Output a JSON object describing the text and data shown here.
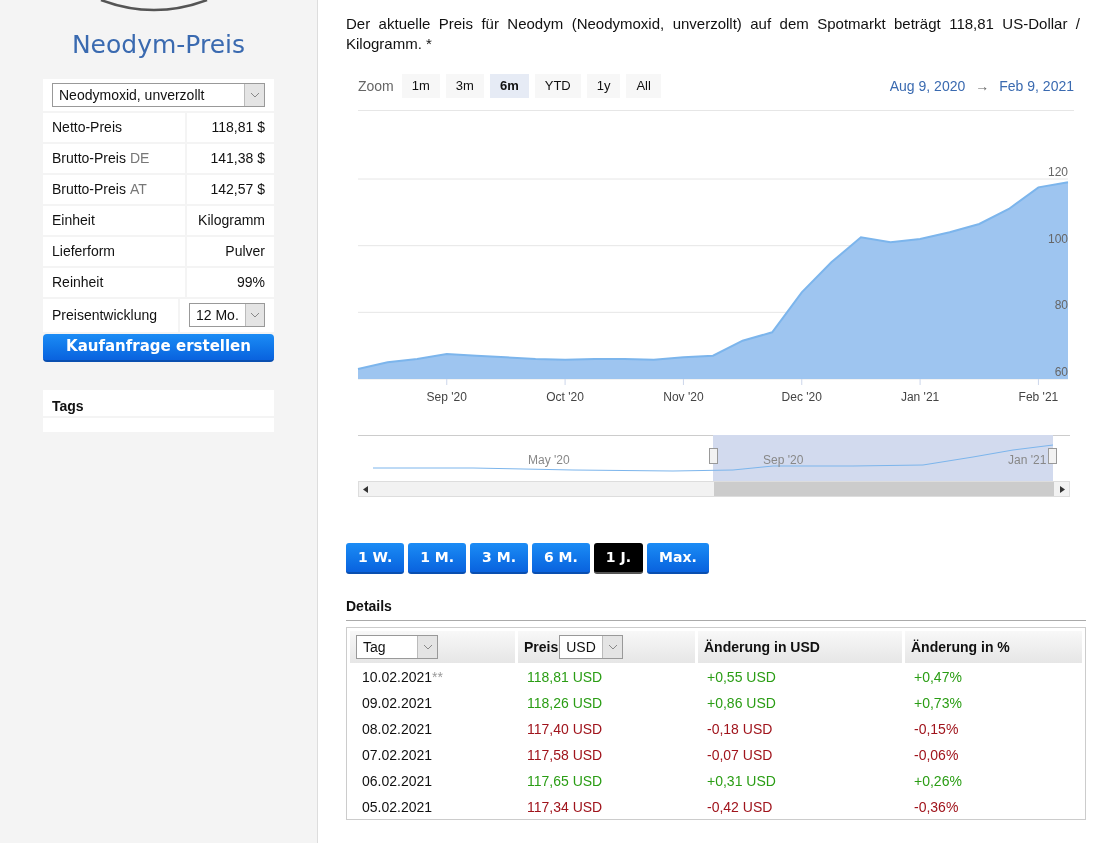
{
  "sidebar": {
    "title": "Neodym-Preis",
    "product_select": {
      "value": "Neodymoxid, unverzollt"
    },
    "rows": [
      {
        "label": "Netto-Preis",
        "value": "118,81 $"
      },
      {
        "label": "Brutto-Preis",
        "suffix": "DE",
        "value": "141,38 $"
      },
      {
        "label": "Brutto-Preis",
        "suffix": "AT",
        "value": "142,57 $"
      },
      {
        "label": "Einheit",
        "value": "Kilogramm"
      },
      {
        "label": "Lieferform",
        "value": "Pulver"
      },
      {
        "label": "Reinheit",
        "value": "99%"
      }
    ],
    "trend_row": {
      "label": "Preisentwicklung",
      "select_value": "12 Mo."
    },
    "request_button": "Kaufanfrage erstellen",
    "tags_heading": "Tags"
  },
  "intro": "Der aktuelle Preis für Neodym (Neodymoxid, unverzollt) auf dem Spotmarkt beträgt 118,81 US-Dollar / Kilogramm. *",
  "chart": {
    "zoom_label": "Zoom",
    "zoom_buttons": [
      {
        "label": "1m",
        "selected": false
      },
      {
        "label": "3m",
        "selected": false
      },
      {
        "label": "6m",
        "selected": true
      },
      {
        "label": "YTD",
        "selected": false
      },
      {
        "label": "1y",
        "selected": false
      },
      {
        "label": "All",
        "selected": false
      }
    ],
    "range_from": "Aug 9, 2020",
    "range_arrow": "→",
    "range_to": "Feb 9, 2021",
    "chart_data": {
      "type": "area",
      "categories": [
        null,
        null,
        null,
        "Sep '20",
        null,
        null,
        null,
        "Oct '20",
        null,
        null,
        null,
        "Nov '20",
        null,
        null,
        null,
        "Dec '20",
        null,
        null,
        null,
        "Jan '21",
        null,
        null,
        null,
        "Feb '21",
        null
      ],
      "series": [
        {
          "color": "#9ec5f0",
          "values": [
            63,
            65,
            66,
            67.5,
            67,
            66.5,
            66,
            65.8,
            66,
            66,
            65.8,
            66.5,
            67,
            71.5,
            74,
            86,
            95,
            102.5,
            101,
            102,
            104,
            106.5,
            111,
            117.5,
            119
          ]
        }
      ],
      "grid": true,
      "ylim": [
        60,
        120
      ],
      "yticks": [
        60,
        80,
        100,
        120
      ]
    },
    "navigator_labels": [
      "May '20",
      "Sep '20",
      "Jan '21"
    ]
  },
  "range_buttons": [
    {
      "label": "1 W.",
      "selected": false
    },
    {
      "label": "1 M.",
      "selected": false
    },
    {
      "label": "3 M.",
      "selected": false
    },
    {
      "label": "6 M.",
      "selected": false
    },
    {
      "label": "1 J.",
      "selected": true
    },
    {
      "label": "Max.",
      "selected": false
    }
  ],
  "details": {
    "heading": "Details",
    "columns": {
      "day_select": "Tag",
      "price_label": "Preis",
      "currency_select": "USD",
      "change_abs": "Änderung in USD",
      "change_pct": "Änderung in %"
    },
    "rows": [
      {
        "date": "10.02.2021",
        "note": "**",
        "price": "118,81 USD",
        "change": "+0,55 USD",
        "pct": "+0,47%",
        "color": "#2a9d14"
      },
      {
        "date": "09.02.2021",
        "price": "118,26 USD",
        "change": "+0,86 USD",
        "pct": "+0,73%",
        "color": "#2a9d14"
      },
      {
        "date": "08.02.2021",
        "price": "117,40 USD",
        "change": "-0,18 USD",
        "pct": "-0,15%",
        "color": "#a0141c"
      },
      {
        "date": "07.02.2021",
        "price": "117,58 USD",
        "change": "-0,07 USD",
        "pct": "-0,06%",
        "color": "#a0141c"
      },
      {
        "date": "06.02.2021",
        "price": "117,65 USD",
        "change": "+0,31 USD",
        "pct": "+0,26%",
        "color": "#2a9d14"
      },
      {
        "date": "05.02.2021",
        "price": "117,34 USD",
        "change": "-0,42 USD",
        "pct": "-0,36%",
        "color": "#a0141c"
      }
    ]
  }
}
